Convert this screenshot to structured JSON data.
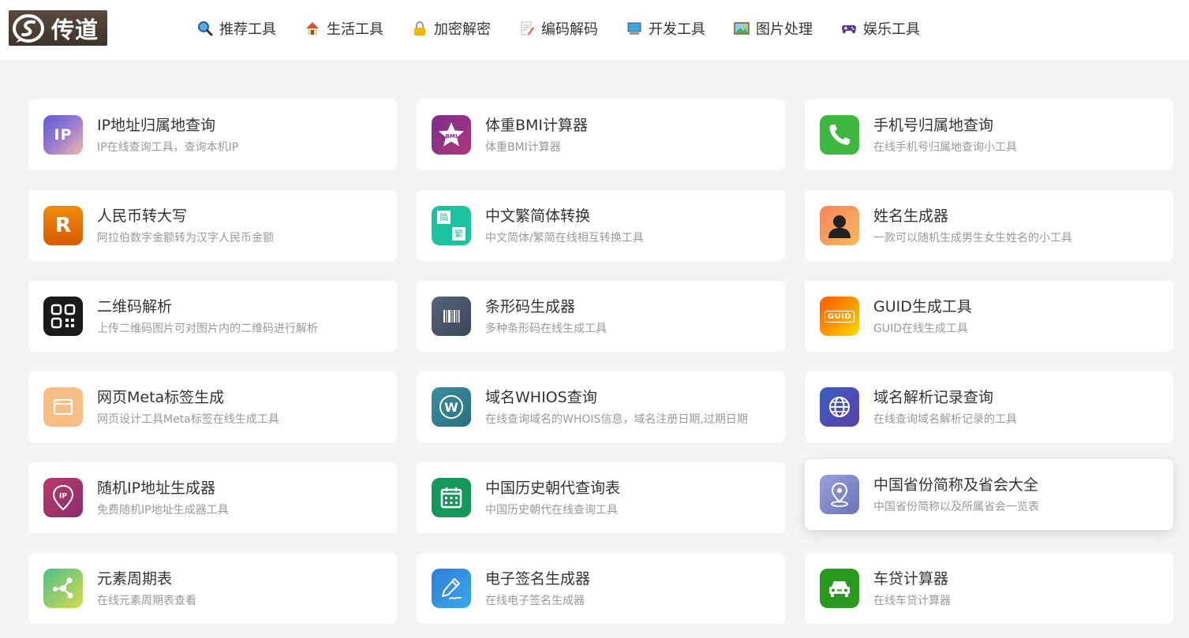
{
  "header": {
    "logo_text": "传道",
    "nav": [
      {
        "label": "推荐工具",
        "icon": "magnifier-icon"
      },
      {
        "label": "生活工具",
        "icon": "house-icon"
      },
      {
        "label": "加密解密",
        "icon": "lock-icon"
      },
      {
        "label": "编码解码",
        "icon": "memo-icon"
      },
      {
        "label": "开发工具",
        "icon": "computer-icon"
      },
      {
        "label": "图片处理",
        "icon": "picture-icon"
      },
      {
        "label": "娱乐工具",
        "icon": "gamepad-icon"
      }
    ]
  },
  "tools": [
    {
      "title": "IP地址归属地查询",
      "desc": "IP在线查询工具，查询本机IP",
      "icon": "ip-icon",
      "icon_text": "IP"
    },
    {
      "title": "体重BMI计算器",
      "desc": "体重BMI计算器",
      "icon": "bmi-star-icon",
      "icon_text": "BMI"
    },
    {
      "title": "手机号归属地查询",
      "desc": "在线手机号归属地查询小工具",
      "icon": "phone-icon"
    },
    {
      "title": "人民币转大写",
      "desc": "阿拉伯数字金额转为汉字人民币金额",
      "icon": "letter-r-icon",
      "icon_text": "R"
    },
    {
      "title": "中文繁简体转换",
      "desc": "中文简体/繁简在线相互转换工具",
      "icon": "traditional-simplified-icon",
      "icon_text_a": "简",
      "icon_text_b": "繁"
    },
    {
      "title": "姓名生成器",
      "desc": "一款可以随机生成男生女生姓名的小工具",
      "icon": "person-icon"
    },
    {
      "title": "二维码解析",
      "desc": "上传二维码图片可对图片内的二维码进行解析",
      "icon": "qr-code-icon"
    },
    {
      "title": "条形码生成器",
      "desc": "多种条形码在线生成工具",
      "icon": "barcode-icon"
    },
    {
      "title": "GUID生成工具",
      "desc": "GUID在线生成工具",
      "icon": "guid-icon",
      "icon_text": "GUID"
    },
    {
      "title": "网页Meta标签生成",
      "desc": "网页设计工具Meta标签在线生成工具",
      "icon": "browser-window-icon"
    },
    {
      "title": "域名WHIOS查询",
      "desc": "在线查询域名的WHOIS信息，域名注册日期,过期日期",
      "icon": "whois-w-icon",
      "icon_text": "W"
    },
    {
      "title": "域名解析记录查询",
      "desc": "在线查询域名解析记录的工具",
      "icon": "globe-icon"
    },
    {
      "title": "随机IP地址生成器",
      "desc": "免费随机IP地址生成器工具",
      "icon": "ip-pin-icon",
      "icon_text": "IP"
    },
    {
      "title": "中国历史朝代查询表",
      "desc": "中国历史朝代在线查询工具",
      "icon": "calendar-icon"
    },
    {
      "title": "中国省份简称及省会大全",
      "desc": "中国省份简称以及所属省会一览表",
      "icon": "map-pin-icon"
    },
    {
      "title": "元素周期表",
      "desc": "在线元素周期表查看",
      "icon": "molecule-icon"
    },
    {
      "title": "电子签名生成器",
      "desc": "在线电子签名生成器",
      "icon": "signature-pen-icon"
    },
    {
      "title": "车贷计算器",
      "desc": "在线车贷计算器",
      "icon": "car-icon"
    }
  ],
  "colors": {
    "page_bg": "#f4f4f4",
    "card_bg": "#ffffff",
    "title": "#333333",
    "desc": "#999999"
  }
}
